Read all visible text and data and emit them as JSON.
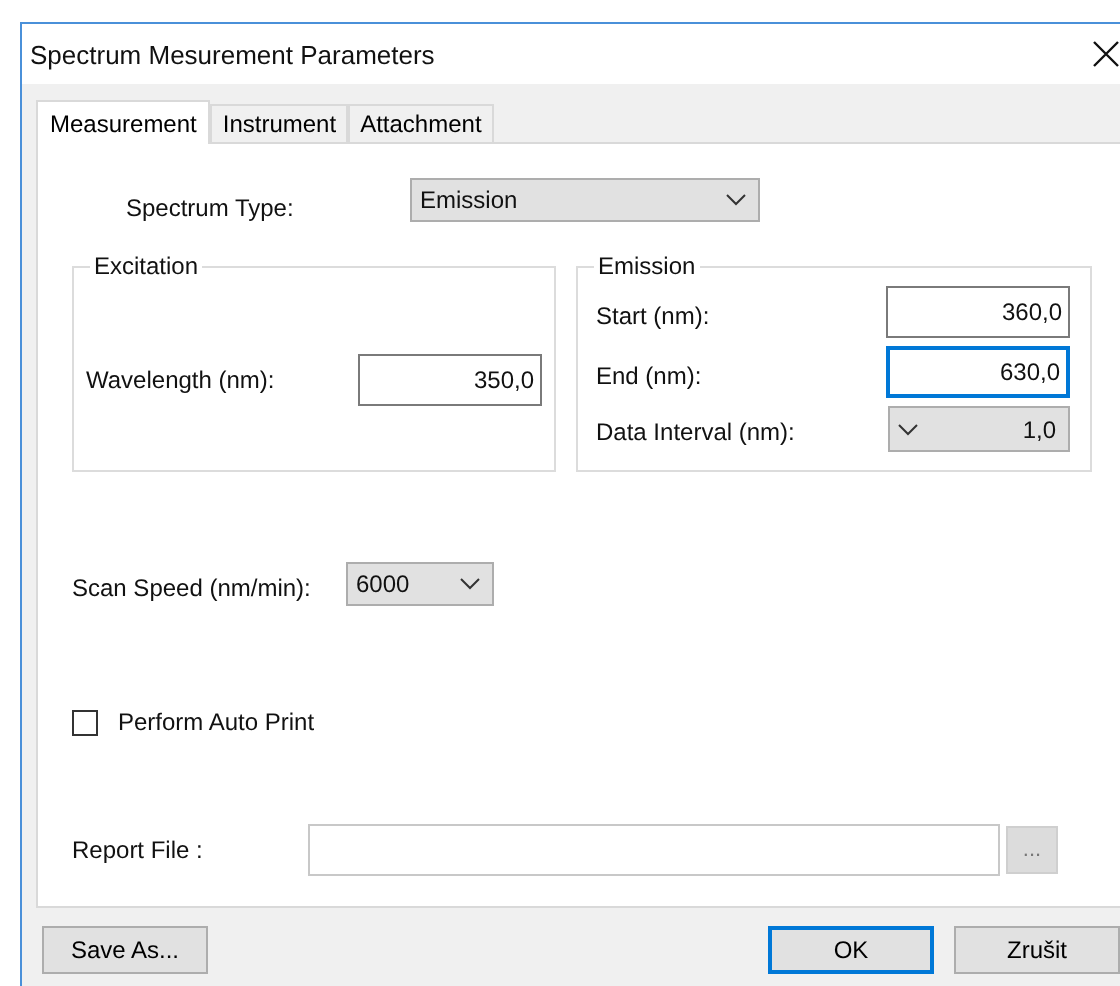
{
  "window": {
    "title": "Spectrum Mesurement Parameters"
  },
  "tabs": [
    {
      "label": "Measurement",
      "selected": true
    },
    {
      "label": "Instrument",
      "selected": false
    },
    {
      "label": "Attachment",
      "selected": false
    }
  ],
  "spectrum_type": {
    "label": "Spectrum Type:",
    "value": "Emission"
  },
  "excitation": {
    "title": "Excitation",
    "fields": [
      {
        "label": "Wavelength (nm):",
        "value": "350,0"
      }
    ]
  },
  "emission": {
    "title": "Emission",
    "fields": [
      {
        "label": "Start (nm):",
        "value": "360,0",
        "kind": "input",
        "focused": false
      },
      {
        "label": "End (nm):",
        "value": "630,0",
        "kind": "input",
        "focused": true
      },
      {
        "label": "Data Interval (nm):",
        "value": "1,0",
        "kind": "dropdown"
      }
    ]
  },
  "scan_speed": {
    "label": "Scan Speed (nm/min):",
    "value": "6000"
  },
  "auto_print": {
    "label": "Perform Auto Print",
    "checked": false
  },
  "report_file": {
    "label": "Report File :",
    "browse": "..."
  },
  "buttons": [
    {
      "label": "Save As...",
      "default": false
    },
    {
      "label": "OK",
      "default": true
    },
    {
      "label": "Zrušit",
      "default": false
    }
  ]
}
